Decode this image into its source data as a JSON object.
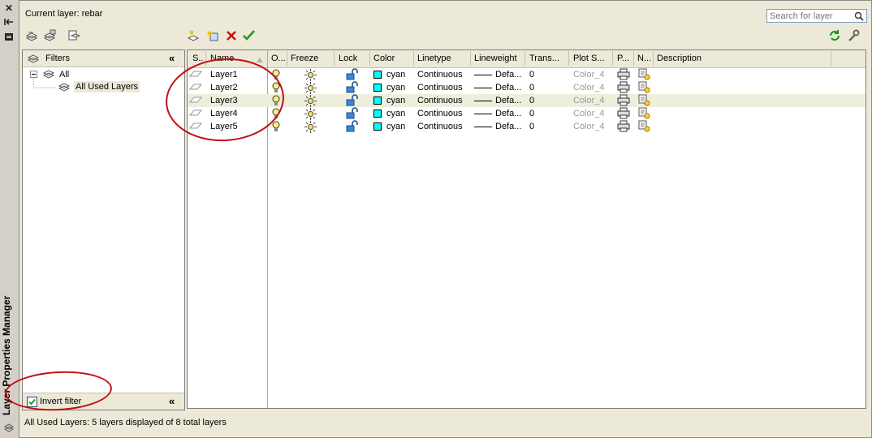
{
  "palette": {
    "title": "Layer Properties Manager"
  },
  "header": {
    "current_layer": "Current layer: rebar",
    "search_placeholder": "Search for layer"
  },
  "filter_panel": {
    "title": "Filters",
    "tree": [
      {
        "label": "All"
      },
      {
        "label": "All Used Layers"
      }
    ],
    "invert_filter_label": "Invert filter",
    "invert_filter_checked": true
  },
  "layer_table": {
    "columns": {
      "status": "S...",
      "name": "Name",
      "on": "O...",
      "freeze": "Freeze",
      "lock": "Lock",
      "color": "Color",
      "linetype": "Linetype",
      "lineweight": "Lineweight",
      "transparency": "Trans...",
      "plot_style": "Plot S...",
      "plot": "P...",
      "new_vp_freeze": "N...",
      "description": "Description"
    },
    "rows": [
      {
        "name": "Layer1",
        "color": "cyan",
        "linetype": "Continuous",
        "lineweight": "Defa...",
        "transparency": "0",
        "plot_style": "Color_4"
      },
      {
        "name": "Layer2",
        "color": "cyan",
        "linetype": "Continuous",
        "lineweight": "Defa...",
        "transparency": "0",
        "plot_style": "Color_4"
      },
      {
        "name": "Layer3",
        "color": "cyan",
        "linetype": "Continuous",
        "lineweight": "Defa...",
        "transparency": "0",
        "plot_style": "Color_4"
      },
      {
        "name": "Layer4",
        "color": "cyan",
        "linetype": "Continuous",
        "lineweight": "Defa...",
        "transparency": "0",
        "plot_style": "Color_4"
      },
      {
        "name": "Layer5",
        "color": "cyan",
        "linetype": "Continuous",
        "lineweight": "Defa...",
        "transparency": "0",
        "plot_style": "Color_4"
      }
    ],
    "selected_row": "Layer3"
  },
  "status_bar": {
    "text": "All Used Layers: 5 layers displayed of 8 total layers"
  },
  "colors": {
    "layer_color": "#00ffff",
    "annotation": "#c01010",
    "selected_row": "#eeeedd"
  },
  "icons": [
    "close-icon",
    "auto-hide-icon",
    "properties-icon",
    "new-filter-icon",
    "new-group-filter-icon",
    "state-manager-icon",
    "new-layer-icon",
    "new-layer-vp-frozen-icon",
    "delete-layer-icon",
    "set-current-icon",
    "refresh-icon",
    "settings-icon",
    "search-icon",
    "collapse-icon",
    "lightbulb-icon",
    "sun-icon",
    "unlock-icon",
    "printer-icon",
    "vp-freeze-icon",
    "layer-status-icon"
  ]
}
